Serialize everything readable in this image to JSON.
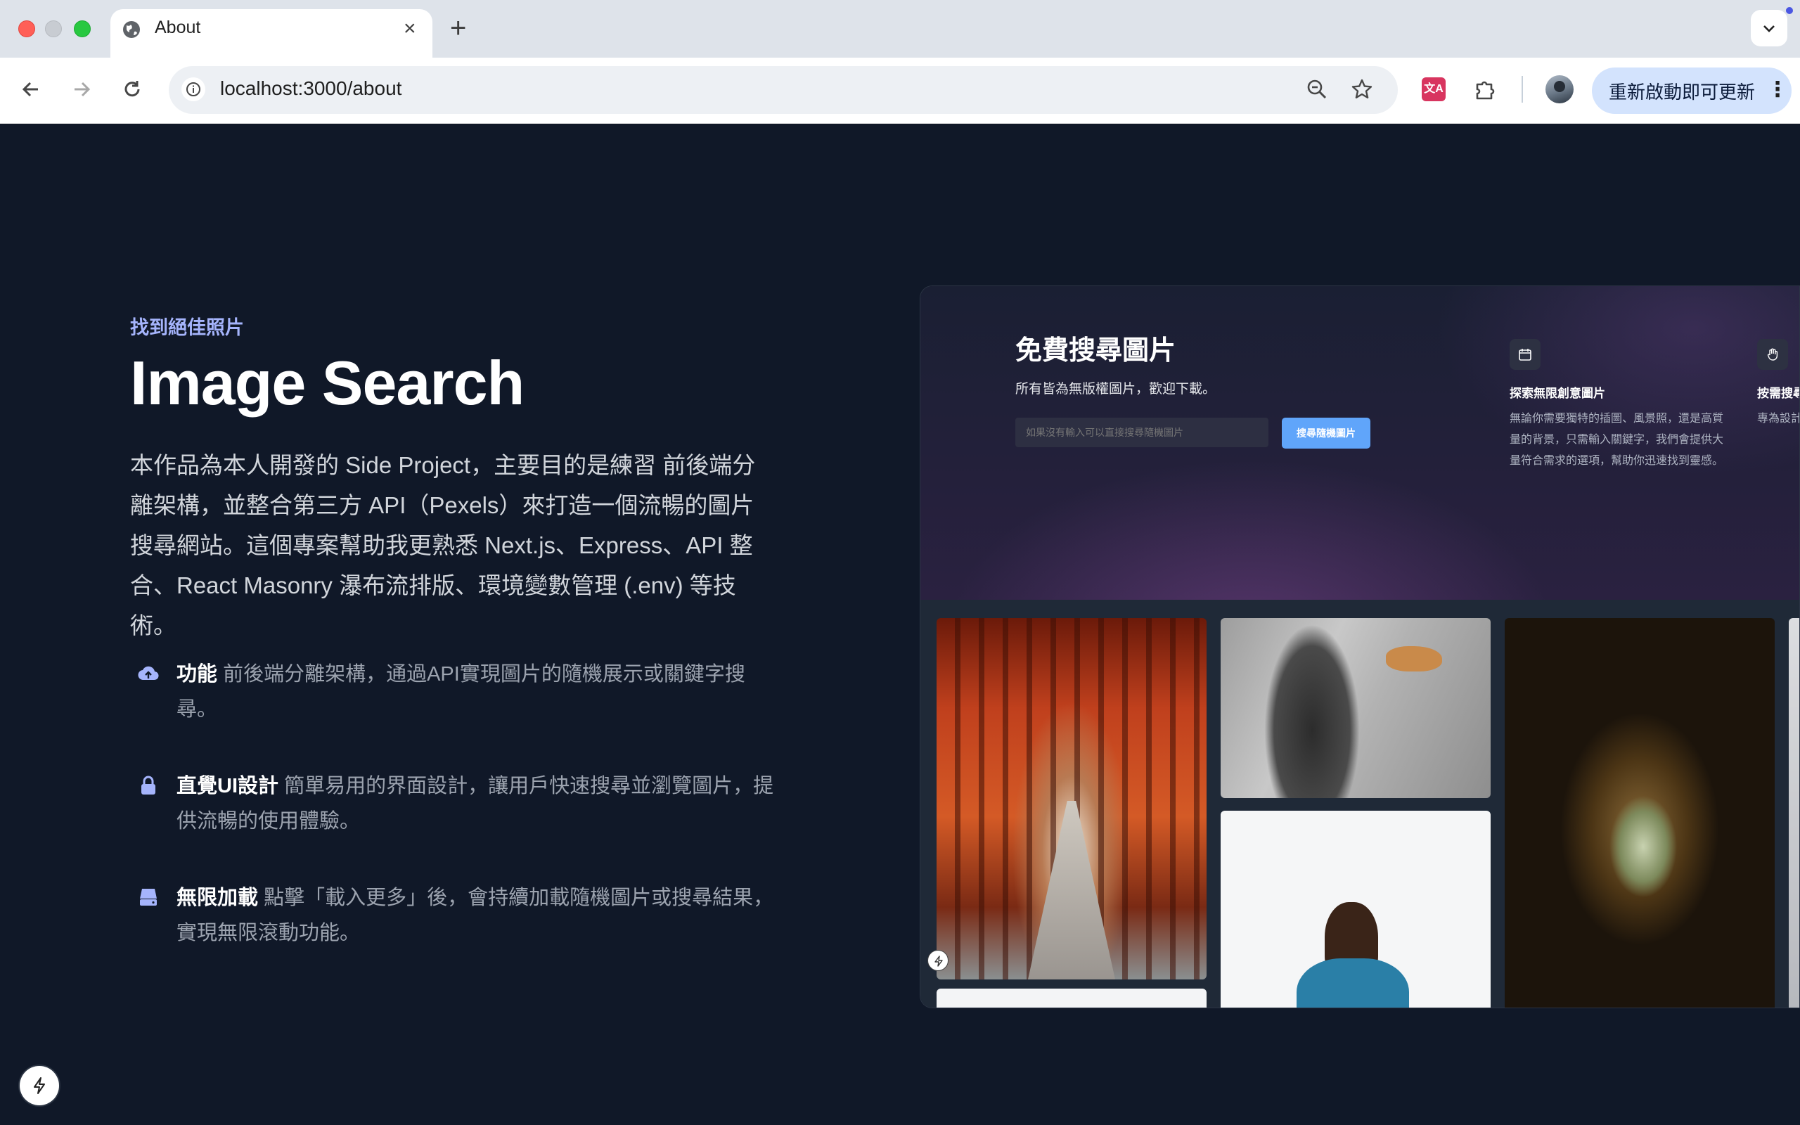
{
  "browser": {
    "tab_title": "About",
    "tab_close": "×",
    "new_tab": "+",
    "url": "localhost:3000/about",
    "update_label": "重新啟動即可更新",
    "kebab": "⋮",
    "translate_glyph": "文A"
  },
  "hero": {
    "eyebrow": "找到絕佳照片",
    "title": "Image Search",
    "description": "本作品為本人開發的 Side Project，主要目的是練習 前後端分離架構，並整合第三方 API（Pexels）來打造一個流暢的圖片搜尋網站。這個專案幫助我更熟悉 Next.js、Express、API 整合、React Masonry 瀑布流排版、環境變數管理 (.env) 等技術。"
  },
  "features": [
    {
      "icon": "cloud-upload-icon",
      "title": "功能",
      "text": "前後端分離架構，通過API實現圖片的隨機展示或關鍵字搜尋。"
    },
    {
      "icon": "lock-icon",
      "title": "直覺UI設計",
      "text": "簡單易用的界面設計，讓用戶快速搜尋並瀏覽圖片，提供流暢的使用體驗。"
    },
    {
      "icon": "server-icon",
      "title": "無限加載",
      "text": "點擊「載入更多」後，會持續加載隨機圖片或搜尋結果，實現無限滾動功能。"
    }
  ],
  "mockup": {
    "title": "免費搜尋圖片",
    "subtitle": "所有皆為無版權圖片，歡迎下載。",
    "search_placeholder": "如果沒有輸入可以直接搜尋隨機圖片",
    "search_button": "搜尋隨機圖片",
    "feature_cards": [
      {
        "icon": "calendar-icon",
        "title": "探索無限創意圖片",
        "desc": "無論你需要獨特的插圖、風景照，還是高質量的背景，只需輸入關鍵字，我們會提供大量符合需求的選項，幫助你迅速找到靈感。"
      },
      {
        "icon": "hand-icon",
        "title": "按需搜尋",
        "desc": "專為設計、適合所。"
      }
    ]
  },
  "colors": {
    "page_bg": "#101828",
    "accent": "#a5b4fc",
    "button_blue": "#60a5fa",
    "chrome_update_pill": "#d3e3fd"
  }
}
